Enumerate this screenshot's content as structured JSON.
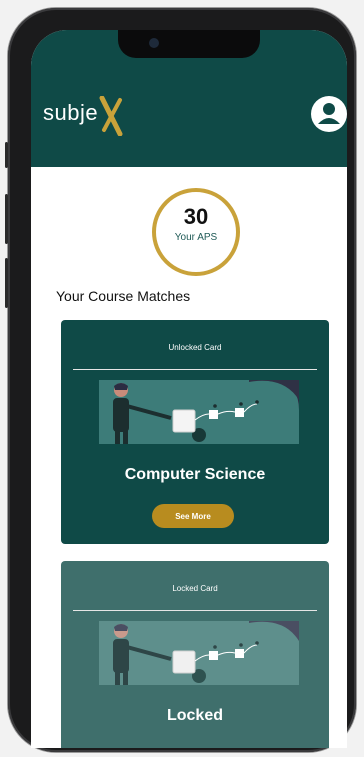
{
  "app": {
    "logo_text": "subje"
  },
  "aps": {
    "value": "30",
    "label": "Your APS"
  },
  "section": {
    "title": "Your Course Matches"
  },
  "cards": [
    {
      "header": "Unlocked Card",
      "title": "Computer Science",
      "button_label": "See More"
    },
    {
      "header": "Locked Card",
      "title": "Locked"
    }
  ],
  "colors": {
    "header_bg": "#0f4a47",
    "accent_gold": "#c9a23a",
    "button_gold": "#b88c1f",
    "locked_card_bg": "#3f6f6c"
  },
  "icons": [
    "user-avatar-icon",
    "presentation-illustration"
  ]
}
